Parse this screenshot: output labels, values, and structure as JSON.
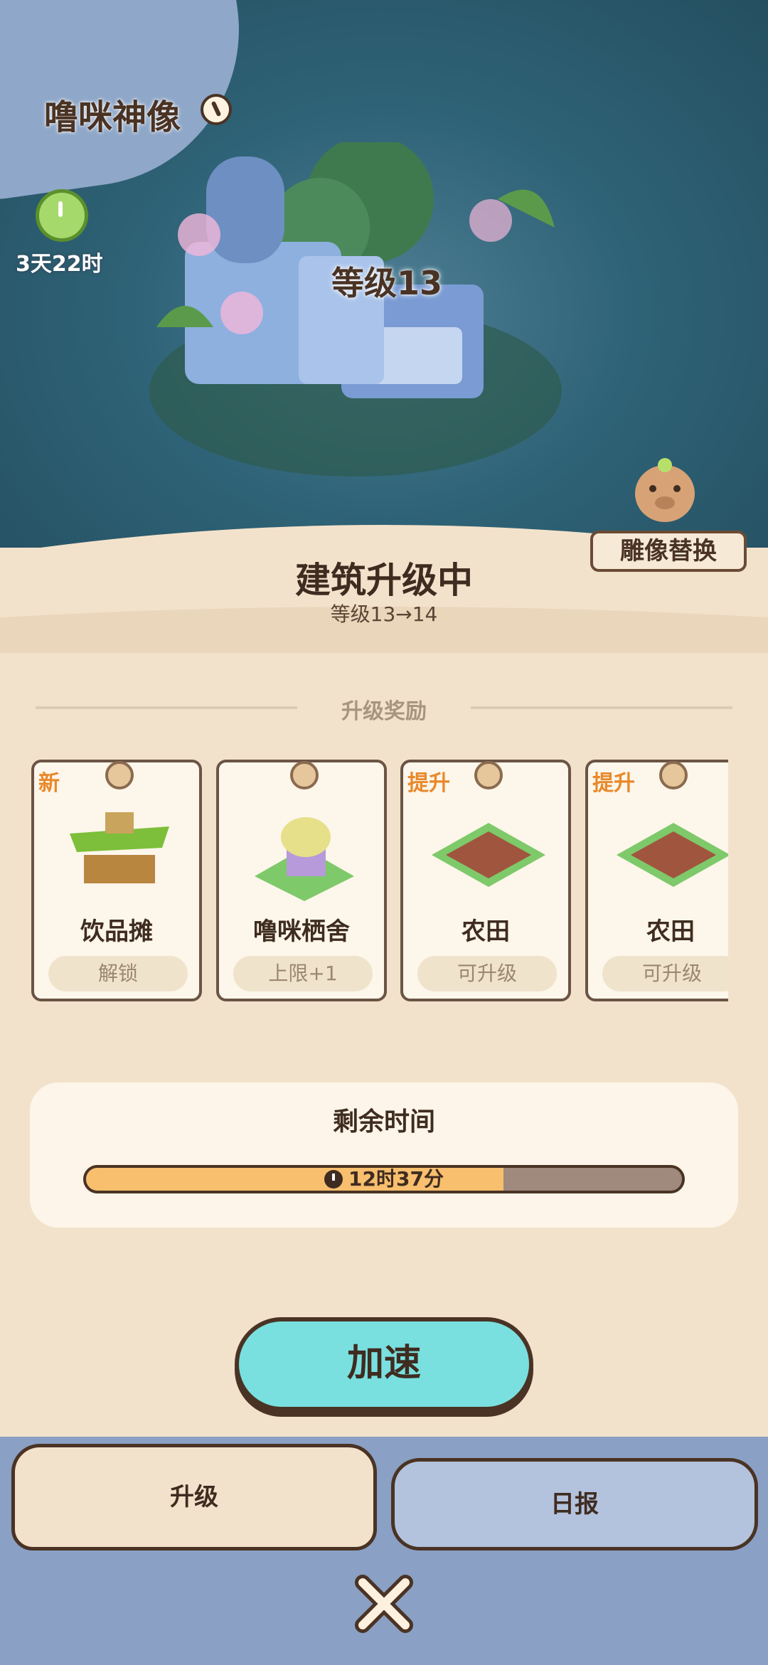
{
  "building": {
    "name": "噜咪神像",
    "timer": "3天22时",
    "level_label": "等级13",
    "statue_button": "雕像替换"
  },
  "status": {
    "title": "建筑升级中",
    "level_change": "等级13→14"
  },
  "rewards": {
    "title": "升级奖励",
    "items": [
      {
        "tag": "新",
        "name": "饮品摊",
        "action": "解锁",
        "icon": "drink-stall-icon"
      },
      {
        "tag": "",
        "name": "噜咪栖舍",
        "action": "上限+1",
        "icon": "lumi-house-icon"
      },
      {
        "tag": "提升",
        "name": "农田",
        "action": "可升级",
        "icon": "farmland-icon"
      },
      {
        "tag": "提升",
        "name": "农田",
        "action": "可升级",
        "icon": "farmland-icon"
      }
    ]
  },
  "time": {
    "label": "剩余时间",
    "remaining": "12时37分",
    "progress": 0.7
  },
  "speedup_label": "加速",
  "tabs": {
    "upgrade": "升级",
    "report": "日报"
  },
  "colors": {
    "accent": "#79e0df",
    "progress": "#f7bf6e",
    "tag": "#e8892b"
  }
}
